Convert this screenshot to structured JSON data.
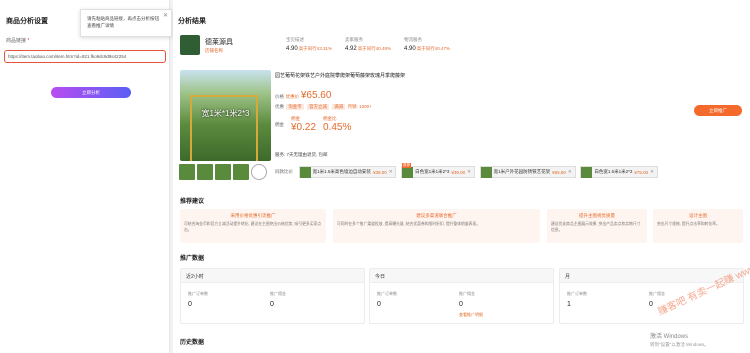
{
  "left": {
    "title": "商品分析设置",
    "field_label": "商品链接",
    "url_value": "https://item.taobao.com/item.htm?id=921 fko9dc9d9s42254",
    "analyze_button": "立即分析"
  },
  "tooltip": {
    "text": "请先粘贴商品链接，再点击分析按钮查看推广详情"
  },
  "right": {
    "title": "分析结果",
    "shop": {
      "name": "德莱源具",
      "tag": "店铺名称"
    },
    "metrics": [
      {
        "label": "宝贝描述",
        "value": "4.90",
        "diff": "高于同行43.31%"
      },
      {
        "label": "卖家服务",
        "value": "4.92",
        "diff": "高于同行40.48%"
      },
      {
        "label": "物流服务",
        "value": "4.90",
        "diff": "高于同行40.47%"
      }
    ],
    "product": {
      "title": "园艺葡萄花架铁艺户外庭院攀爬架葡萄藤架玫瑰月季爬藤架",
      "image_text": "宽1米*1米2*3",
      "price_label": "价格",
      "price_sub": "优惠价",
      "price": "¥65.60",
      "promo_label": "优惠",
      "promo_tags": [
        "淘金币",
        "官方立减",
        "满减"
      ],
      "promo_extra": "月销: 1000+",
      "commission_label": "佣金",
      "commission_items": [
        {
          "k": "佣金",
          "v": "¥0.22"
        },
        {
          "k": "佣金比",
          "v": "0.45%"
        }
      ],
      "desc": "服务: 7天无理由退货, 包邮",
      "promote_button": "立即推广"
    },
    "compare": {
      "label": "同款比价",
      "items": [
        {
          "badge": "",
          "text": "宽1米1.5米高色墙边自动安装",
          "price": "¥39.00"
        },
        {
          "badge": "推荐",
          "text": "白色宽1米1米2*3",
          "price": "¥39.00"
        },
        {
          "badge": "",
          "text": "宽1米户外花园防锈铁艺花架",
          "price": "¥65.60"
        },
        {
          "badge": "",
          "text": "白色宽1.5米1米2*3",
          "price": "¥75.00"
        }
      ]
    },
    "recommend": {
      "title": "推荐建议",
      "cards": [
        {
          "h": "采用价格优惠引流推广",
          "b": "可结合淘金币和官方立减活动提升转化, 建议在主图突出价格优势, 吸引更多买家点击。"
        },
        {
          "h": "建议多渠道联合推广",
          "b": "可同时在多个推广渠道投放, 提高曝光量, 结合优惠券和限时折扣, 提升整体销量表现。"
        },
        {
          "h": "提升主图视觉质量",
          "b": "建议优化商品主图展示效果, 突出产品卖点和实物尺寸信息。"
        },
        {
          "h": "设计主图",
          "b": "突出尺寸规格, 提升点击率和转化率。"
        }
      ]
    },
    "promo_data": {
      "title": "推广数据",
      "cards": [
        {
          "period": "近2小时",
          "k1": "推广订单数",
          "v1": "0",
          "k2": "推广佣金",
          "v2": "0"
        },
        {
          "period": "今日",
          "k1": "推广订单数",
          "v1": "0",
          "k2": "推广佣金",
          "v2": "0",
          "link": "查看推广明细"
        },
        {
          "period": "月",
          "k1": "推广订单数",
          "v1": "1",
          "k2": "推广佣金",
          "v2": "0"
        }
      ]
    },
    "history_title": "历史数据"
  },
  "watermark": "赚客吧 有卖一起赚 www.zuanke8.com",
  "windows": {
    "line1": "激活 Windows",
    "line2": "转到\"设置\"以激活 Windows。"
  }
}
